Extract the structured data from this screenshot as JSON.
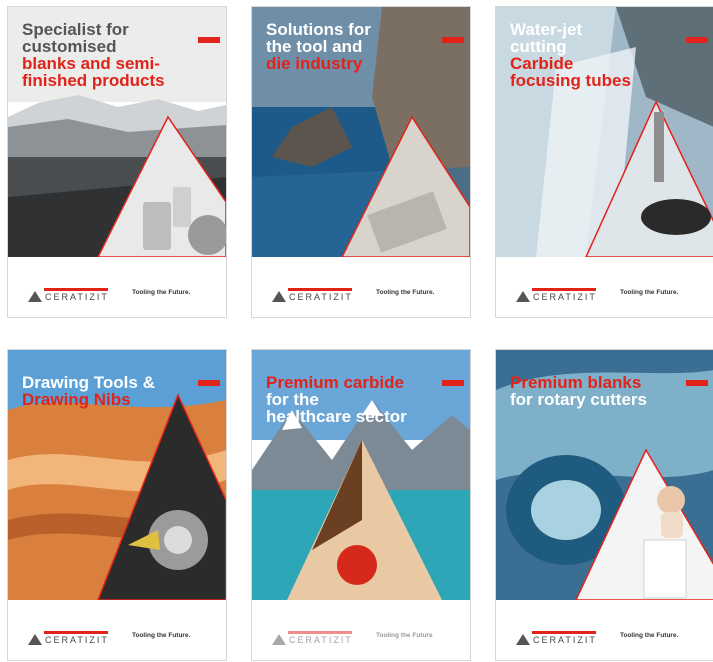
{
  "colors": {
    "accent": "#e2231a",
    "grey_text": "#555555",
    "white": "#ffffff"
  },
  "brochures": [
    {
      "title_lines": [
        {
          "text": "Specialist for",
          "color": "#555555"
        },
        {
          "text": "customised",
          "color": "#555555"
        },
        {
          "text": "blanks and semi-",
          "color": "#e2231a"
        },
        {
          "text": "finished products",
          "color": "#e2231a"
        }
      ],
      "image": "glacier and carbide blanks",
      "brand": "CERATIZIT",
      "slogan": "Tooling the Future."
    },
    {
      "title_lines": [
        {
          "text": "Solutions for",
          "color": "#ffffff"
        },
        {
          "text": "the tool and",
          "color": "#ffffff"
        },
        {
          "text": "die industry",
          "color": "#e2231a"
        }
      ],
      "image": "sea cliffs and die part",
      "brand": "CERATIZIT",
      "slogan": "Tooling the Future."
    },
    {
      "title_lines": [
        {
          "text": "Water-jet",
          "color": "#ffffff"
        },
        {
          "text": "cutting",
          "color": "#ffffff"
        },
        {
          "text": "Carbide",
          "color": "#e2231a"
        },
        {
          "text": "focusing tubes",
          "color": "#e2231a"
        }
      ],
      "image": "waterfall and focusing tube",
      "brand": "CERATIZIT",
      "slogan": "Tooling the Future."
    },
    {
      "title_lines": [
        {
          "text": "Drawing Tools &",
          "color": "#ffffff"
        },
        {
          "text": "Drawing Nibs",
          "color": "#e2231a"
        }
      ],
      "image": "sandstone canyon and wire drawing",
      "brand": "CERATIZIT",
      "slogan": "Tooling the Future."
    },
    {
      "title_lines": [
        {
          "text": "Premium carbide",
          "color": "#e2231a"
        },
        {
          "text": "for the",
          "color": "#ffffff"
        },
        {
          "text": "healthcare sector",
          "color": "#ffffff"
        }
      ],
      "image": "mountain lake and woman with apple",
      "brand": "CERATIZIT",
      "slogan": "Tooling the Future"
    },
    {
      "title_lines": [
        {
          "text": "Premium blanks",
          "color": "#e2231a"
        },
        {
          "text": "for rotary cutters",
          "color": "#ffffff"
        }
      ],
      "image": "ocean wave and baby on stack",
      "brand": "CERATIZIT",
      "slogan": "Tooling the Future."
    }
  ]
}
